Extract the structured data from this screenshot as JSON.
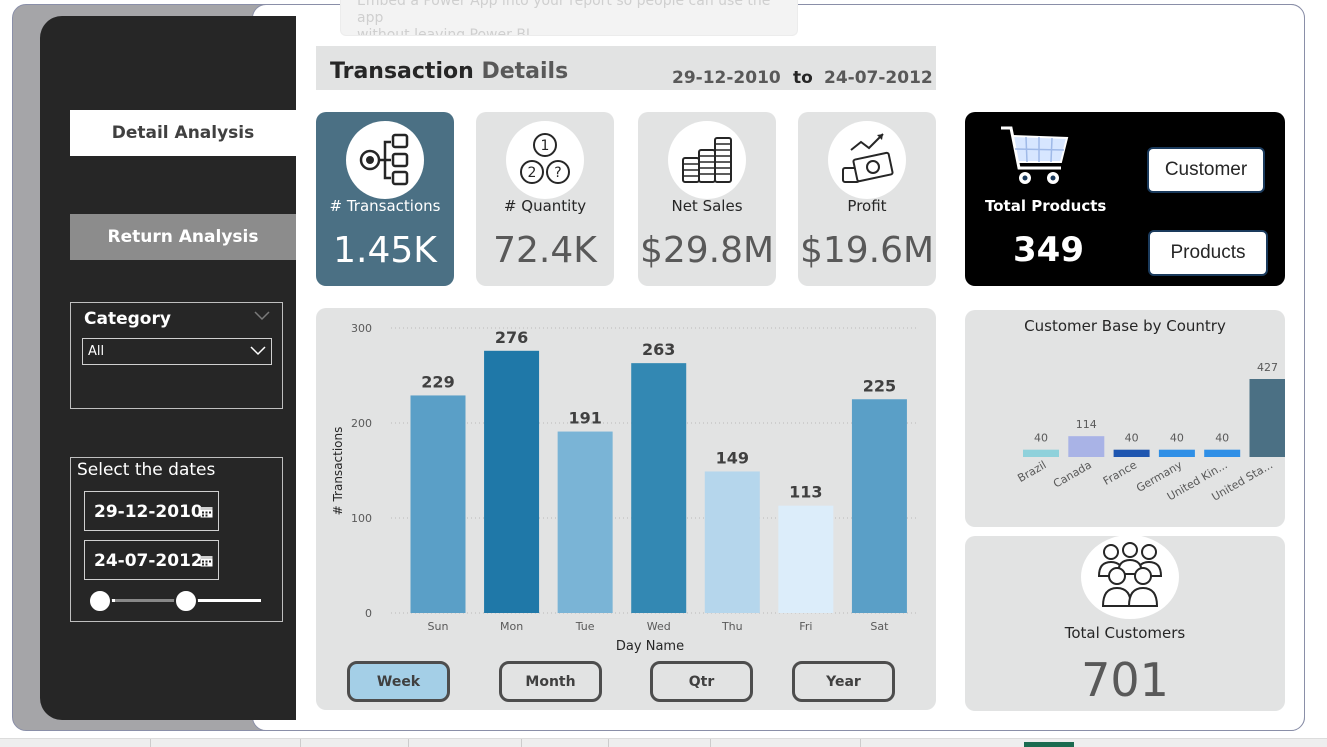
{
  "tooltip": {
    "line1": "Embed a Power App into your report so people can use the app",
    "line2": "without leaving Power BI"
  },
  "nav": {
    "detail_label": "Detail Analysis",
    "return_label": "Return Analysis"
  },
  "category": {
    "title": "Category",
    "selected": "All"
  },
  "dates": {
    "title": "Select the dates",
    "start": "29-12-2010",
    "end": "24-07-2012"
  },
  "header": {
    "title_main": "Transaction",
    "title_sub": "Details",
    "date_from": "29-12-2010",
    "to_label": "to",
    "date_to": "24-07-2012"
  },
  "kpis": {
    "transactions": {
      "label": "# Transactions",
      "value": "1.45K"
    },
    "quantity": {
      "label": "# Quantity",
      "value": "72.4K"
    },
    "net_sales": {
      "label": "Net Sales",
      "value": "$29.8M"
    },
    "profit": {
      "label": "Profit",
      "value": "$19.6M"
    }
  },
  "total_products": {
    "label": "Total Products",
    "value": "349",
    "customer_button": "Customer",
    "products_button": "Products"
  },
  "period_buttons": {
    "week": "Week",
    "month": "Month",
    "qtr": "Qtr",
    "year": "Year"
  },
  "total_customers": {
    "label": "Total Customers",
    "value": "701"
  },
  "colors": {
    "panel_dark": "#262626",
    "kpi_active": "#4b7084",
    "card_gray": "#e2e3e3"
  },
  "chart_data": [
    {
      "type": "bar",
      "title": "",
      "xlabel": "Day Name",
      "ylabel": "# Transactions",
      "ylim": [
        0,
        300
      ],
      "yticks": [
        0,
        100,
        200,
        300
      ],
      "grid": true,
      "categories": [
        "Sun",
        "Mon",
        "Tue",
        "Wed",
        "Thu",
        "Fri",
        "Sat"
      ],
      "values": [
        229,
        276,
        191,
        263,
        149,
        113,
        225
      ],
      "colors": [
        "#5a9fc7",
        "#1f78a8",
        "#7ab4d6",
        "#3388b3",
        "#b5d6ec",
        "#dcedfa",
        "#5a9fc7"
      ]
    },
    {
      "type": "bar",
      "title": "Customer Base by Country",
      "categories": [
        "Brazil",
        "Canada",
        "France",
        "Germany",
        "United Kin...",
        "United Sta..."
      ],
      "values": [
        40,
        114,
        40,
        40,
        40,
        427
      ],
      "colors": [
        "#8fd1db",
        "#a9b3e6",
        "#1f56b0",
        "#2f8fe6",
        "#2f8fe6",
        "#4b7084"
      ]
    }
  ]
}
